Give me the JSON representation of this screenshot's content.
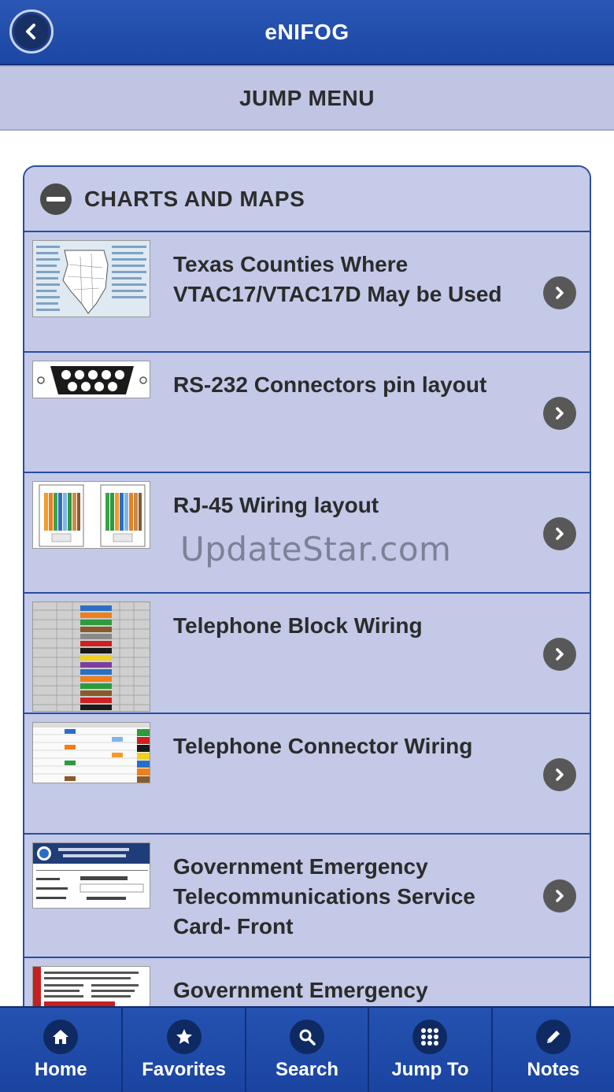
{
  "header": {
    "title": "eNIFOG",
    "back_icon": "chevron-left-icon"
  },
  "jump_bar": {
    "label": "JUMP MENU"
  },
  "section": {
    "title": "CHARTS AND MAPS",
    "toggle_icon": "minus-circle-icon",
    "items": [
      {
        "label": "Texas Counties Where VTAC17/VTAC17D May be Used",
        "thumb": "texas-map-thumbnail"
      },
      {
        "label": "RS-232 Connectors pin layout",
        "thumb": "db9-connector-thumbnail"
      },
      {
        "label": "RJ-45 Wiring layout",
        "thumb": "rj45-wiring-thumbnail",
        "watermark": "UpdateStar.com"
      },
      {
        "label": "Telephone Block Wiring",
        "thumb": "block-wiring-thumbnail"
      },
      {
        "label": "Telephone Connector Wiring",
        "thumb": "connector-wiring-thumbnail"
      },
      {
        "label": "Government Emergency Telecommunications Service Card- Front",
        "thumb": "gets-card-front-thumbnail"
      },
      {
        "label": "Government Emergency",
        "thumb": "gets-card-back-thumbnail"
      }
    ]
  },
  "tabbar": {
    "tabs": [
      {
        "label": "Home",
        "icon": "home-icon"
      },
      {
        "label": "Favorites",
        "icon": "star-icon"
      },
      {
        "label": "Search",
        "icon": "search-icon"
      },
      {
        "label": "Jump To",
        "icon": "grid-icon"
      },
      {
        "label": "Notes",
        "icon": "pencil-icon"
      }
    ]
  },
  "colors": {
    "header_blue": "#1c47a4",
    "row_bg": "#c3c9e7",
    "border_blue": "#2a4da3"
  }
}
